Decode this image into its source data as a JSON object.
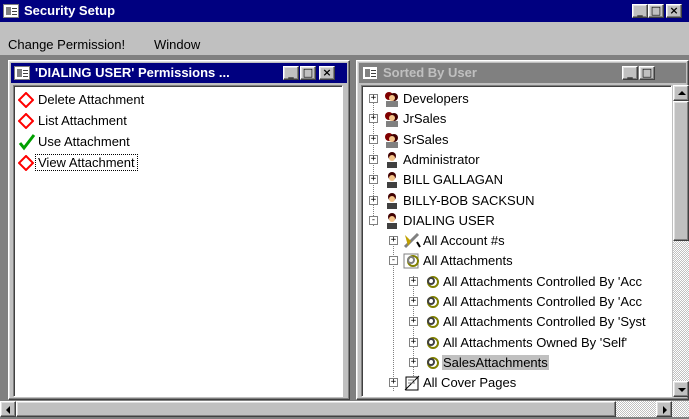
{
  "app": {
    "title": "Security Setup",
    "caption_buttons": [
      "_",
      "□",
      "×"
    ]
  },
  "menu": {
    "items": [
      "Change Permission!",
      "Window"
    ]
  },
  "permissions_window": {
    "title": "'DIALING USER' Permissions ...",
    "items": [
      {
        "label": "Delete Attachment",
        "state": "denied",
        "icon": "red-diamond-icon"
      },
      {
        "label": "List Attachment",
        "state": "denied",
        "icon": "red-diamond-icon"
      },
      {
        "label": "Use Attachment",
        "state": "granted",
        "icon": "green-check-icon"
      },
      {
        "label": "View Attachment",
        "state": "denied",
        "icon": "red-diamond-icon"
      }
    ]
  },
  "tree_window": {
    "title": "Sorted By User",
    "nodes": [
      {
        "label": "Developers",
        "icon": "user-group-icon",
        "expander": "+"
      },
      {
        "label": "JrSales",
        "icon": "user-group-icon",
        "expander": "+"
      },
      {
        "label": "SrSales",
        "icon": "user-group-icon",
        "expander": "+"
      },
      {
        "label": "Administrator",
        "icon": "user-icon",
        "expander": "+"
      },
      {
        "label": "BILL GALLAGAN",
        "icon": "user-icon",
        "expander": "+"
      },
      {
        "label": "BILLY-BOB SACKSUN",
        "icon": "user-icon",
        "expander": "+"
      },
      {
        "label": "DIALING USER",
        "icon": "user-icon",
        "expander": "-"
      },
      {
        "label": "All Account #s",
        "icon": "account-icon",
        "expander": "+"
      },
      {
        "label": "All Attachments",
        "icon": "attachment-group-icon",
        "expander": "-"
      },
      {
        "label": "All Attachments Controlled By 'Acc",
        "icon": "attachment-icon",
        "expander": "+"
      },
      {
        "label": "All Attachments Controlled By 'Acc",
        "icon": "attachment-icon",
        "expander": "+"
      },
      {
        "label": "All Attachments Controlled By 'Syst",
        "icon": "attachment-icon",
        "expander": "+"
      },
      {
        "label": "All Attachments Owned By 'Self'",
        "icon": "attachment-icon",
        "expander": "+"
      },
      {
        "label": "SalesAttachments",
        "icon": "attachment-icon",
        "expander": "+",
        "selected": true
      },
      {
        "label": "All Cover Pages",
        "icon": "cover-page-icon",
        "expander": "+"
      }
    ]
  },
  "colors": {
    "active_title": "#000080",
    "inactive_title": "#808080",
    "face": "#c0c0c0",
    "denied": "#ff0000",
    "granted": "#00a000"
  }
}
